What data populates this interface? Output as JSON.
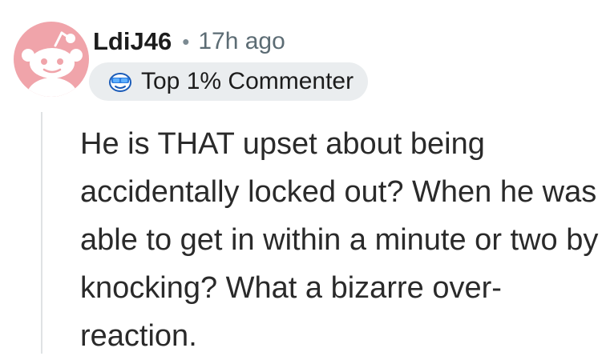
{
  "comment": {
    "author": "LdiJ46",
    "separator": "•",
    "time": "17h ago",
    "badge": {
      "label": "Top 1% Commenter",
      "icon": "snoo-sunglasses-icon"
    },
    "avatar_icon": "snoo-avatar-icon",
    "body": "He is THAT upset about being accidentally locked out? When he was able to get in within a minute or two by knocking? What a bizarre over-reaction."
  },
  "colors": {
    "avatar_bg": "#f0a4aa",
    "badge_bg": "#eaedef",
    "meta_text": "#5c6c74",
    "thread_line": "#dfe2e4"
  }
}
